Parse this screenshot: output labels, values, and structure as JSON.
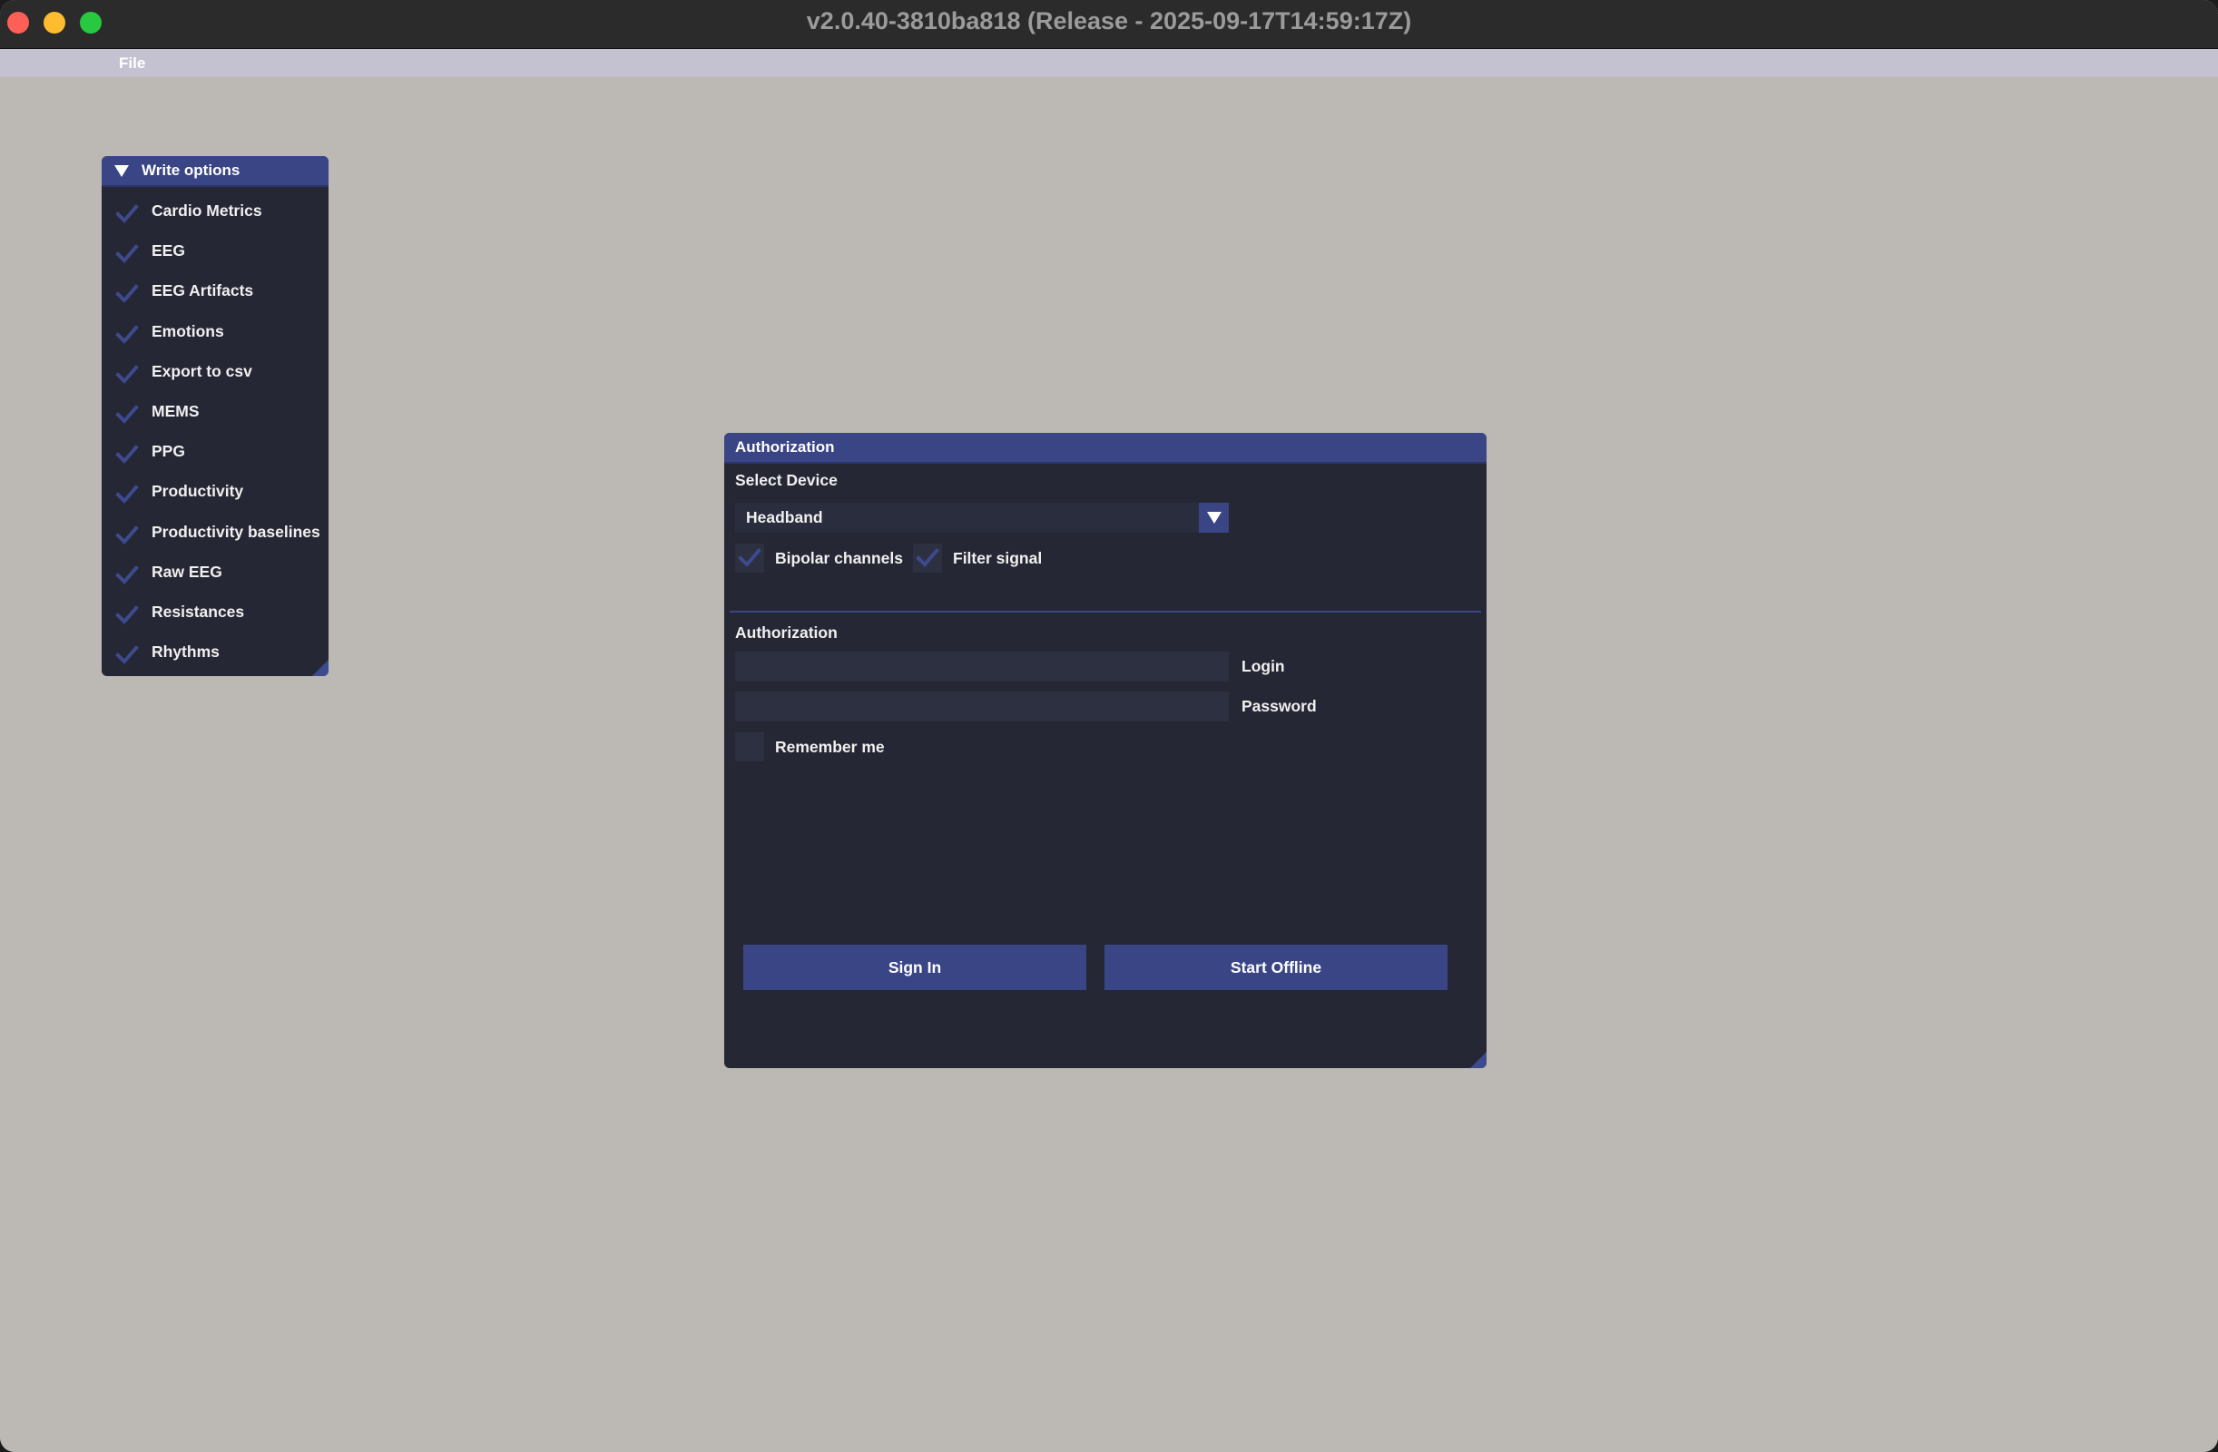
{
  "window": {
    "title": "v2.0.40-3810ba818 (Release - 2025-09-17T14:59:17Z)"
  },
  "menu": {
    "items": [
      "File"
    ]
  },
  "write_options": {
    "title": "Write options",
    "items": [
      {
        "label": "Cardio Metrics",
        "checked": true
      },
      {
        "label": "EEG",
        "checked": true
      },
      {
        "label": "EEG Artifacts",
        "checked": true
      },
      {
        "label": "Emotions",
        "checked": true
      },
      {
        "label": "Export to csv",
        "checked": true
      },
      {
        "label": "MEMS",
        "checked": true
      },
      {
        "label": "PPG",
        "checked": true
      },
      {
        "label": "Productivity",
        "checked": true
      },
      {
        "label": "Productivity baselines",
        "checked": true
      },
      {
        "label": "Raw EEG",
        "checked": true
      },
      {
        "label": "Resistances",
        "checked": true
      },
      {
        "label": "Rhythms",
        "checked": true
      }
    ]
  },
  "auth": {
    "title": "Authorization",
    "select_device_label": "Select Device",
    "device_value": "Headband",
    "bipolar": {
      "label": "Bipolar channels",
      "checked": true
    },
    "filter": {
      "label": "Filter signal",
      "checked": true
    },
    "section_label": "Authorization",
    "login": {
      "label": "Login",
      "value": ""
    },
    "password": {
      "label": "Password",
      "value": ""
    },
    "remember": {
      "label": "Remember me",
      "checked": false
    },
    "sign_in_label": "Sign In",
    "start_offline_label": "Start Offline"
  },
  "colors": {
    "accent": "#3a4585",
    "panel_bg": "#252734",
    "desktop_bg": "#bcb8b4",
    "check_color": "#3e4a8e"
  }
}
